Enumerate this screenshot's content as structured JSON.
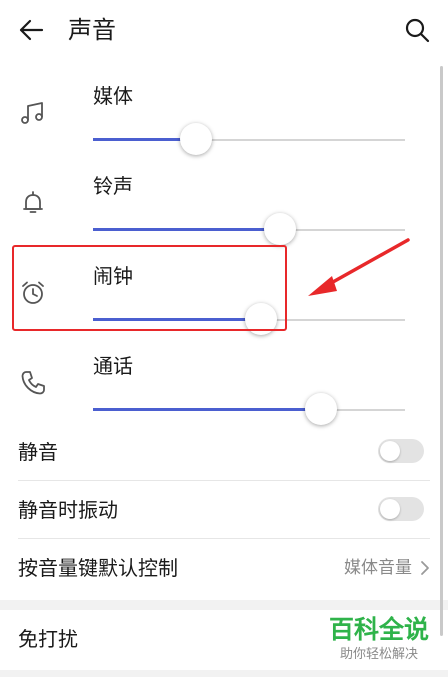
{
  "header": {
    "title": "声音",
    "back_icon": "arrow-left-icon",
    "search_icon": "search-icon"
  },
  "volume": [
    {
      "id": "media",
      "label": "媒体",
      "icon": "music-note-icon",
      "level": 0.33
    },
    {
      "id": "ringtone",
      "label": "铃声",
      "icon": "bell-icon",
      "level": 0.6
    },
    {
      "id": "alarm",
      "label": "闹钟",
      "icon": "alarm-clock-icon",
      "level": 0.54
    },
    {
      "id": "call",
      "label": "通话",
      "icon": "phone-icon",
      "level": 0.73
    }
  ],
  "settings": {
    "mute": {
      "label": "静音",
      "on": false
    },
    "vibrate_on_mute": {
      "label": "静音时振动",
      "on": false
    },
    "volume_keys": {
      "label": "按音量键默认控制",
      "value": "媒体音量"
    },
    "do_not_disturb": {
      "label": "免打扰"
    }
  },
  "watermark": {
    "main": "百科全说",
    "sub": "助你轻松解决"
  },
  "colors": {
    "accent": "#4b5fd0",
    "annotation": "#e8282a",
    "watermark": "#2fb34a",
    "toggle_off": "#e3e3e3"
  }
}
